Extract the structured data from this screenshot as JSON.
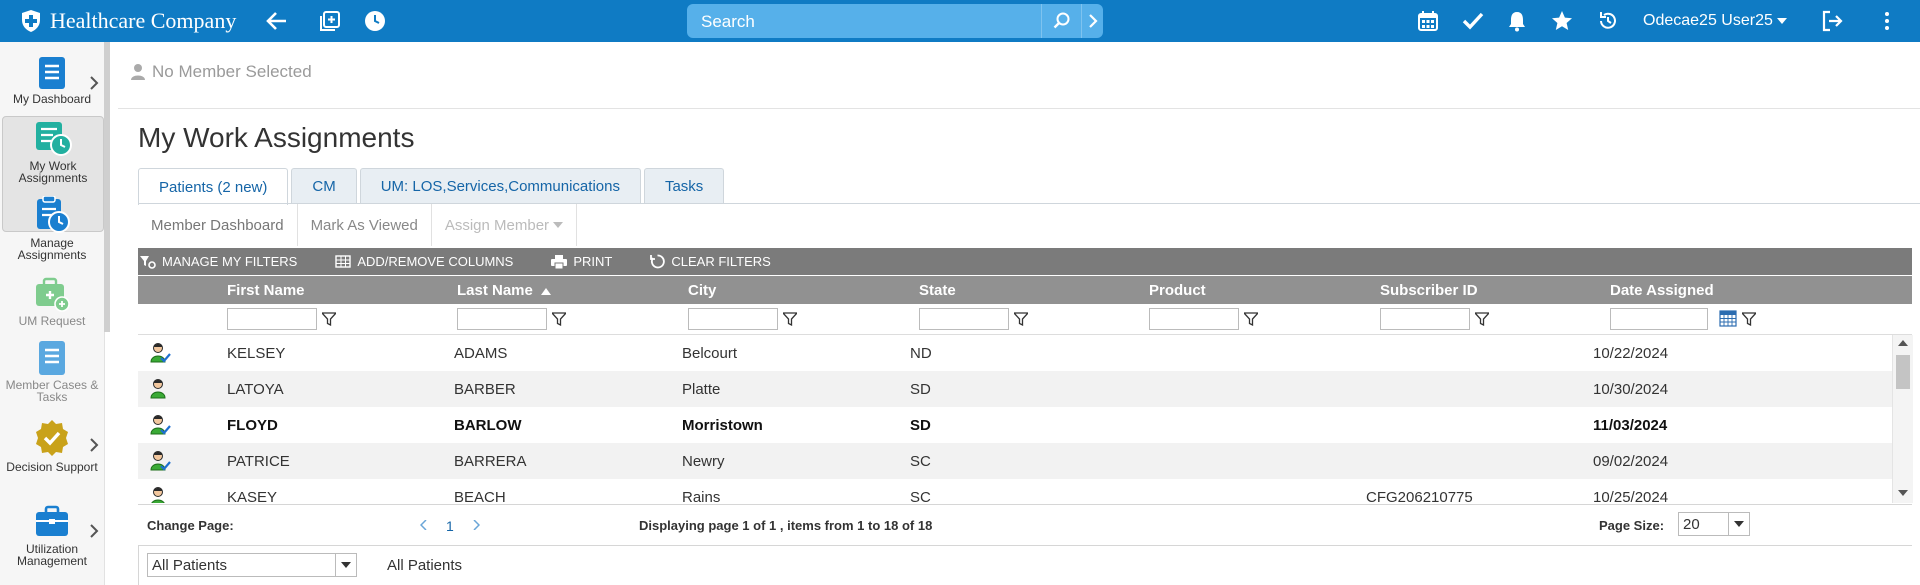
{
  "app": {
    "brand": "Healthcare Company",
    "accent": "#0f7bc4"
  },
  "search": {
    "placeholder": "Search"
  },
  "user": {
    "name": "Odecae25 User25"
  },
  "sidebar": {
    "items": [
      {
        "label": "My Dashboard",
        "icon": "dashboard-doc-icon"
      },
      {
        "label": "My Work Assignments",
        "icon": "work-assignments-icon"
      },
      {
        "label": "Manage Assignments",
        "icon": "manage-assignments-icon"
      },
      {
        "label": "UM Request",
        "icon": "um-request-briefcase-icon"
      },
      {
        "label": "Member Cases & Tasks",
        "icon": "member-cases-doc-icon"
      },
      {
        "label": "Decision Support",
        "icon": "decision-support-badge-icon"
      },
      {
        "label": "Utilization Management",
        "icon": "utilization-briefcase-icon"
      }
    ]
  },
  "member": {
    "status": "No Member Selected"
  },
  "page": {
    "title": "My Work Assignments"
  },
  "tabs": [
    {
      "label": "Patients (2 new)"
    },
    {
      "label": "CM"
    },
    {
      "label": "UM: LOS,Services,Communications"
    },
    {
      "label": "Tasks"
    }
  ],
  "actions": {
    "member_dashboard": "Member Dashboard",
    "mark_as_viewed": "Mark As Viewed",
    "assign_member": "Assign Member"
  },
  "grid": {
    "toolbar": {
      "manage_filters": "MANAGE MY FILTERS",
      "add_remove_columns": "ADD/REMOVE COLUMNS",
      "print": "PRINT",
      "clear_filters": "CLEAR FILTERS"
    },
    "columns": {
      "first_name": "First Name",
      "last_name": "Last Name",
      "city": "City",
      "state": "State",
      "product": "Product",
      "subscriber_id": "Subscriber ID",
      "date_assigned": "Date Assigned"
    },
    "rows": [
      {
        "first": "KELSEY",
        "last": "ADAMS",
        "city": "Belcourt",
        "state": "ND",
        "product": "",
        "subscriber": "",
        "date": "10/22/2024"
      },
      {
        "first": "LATOYA",
        "last": "BARBER",
        "city": "Platte",
        "state": "SD",
        "product": "",
        "subscriber": "",
        "date": "10/30/2024"
      },
      {
        "first": "FLOYD",
        "last": "BARLOW",
        "city": "Morristown",
        "state": "SD",
        "product": "",
        "subscriber": "",
        "date": "11/03/2024"
      },
      {
        "first": "PATRICE",
        "last": "BARRERA",
        "city": "Newry",
        "state": "SC",
        "product": "",
        "subscriber": "",
        "date": "09/02/2024"
      },
      {
        "first": "KASEY",
        "last": "BEACH",
        "city": "Rains",
        "state": "SC",
        "product": "",
        "subscriber": "CFG206210775",
        "date": "10/25/2024"
      }
    ],
    "pager": {
      "change_page": "Change Page:",
      "current_page": "1",
      "summary": "Displaying page 1 of 1 , items from 1 to 18 of 18",
      "page_size_label": "Page Size:",
      "page_size": "20"
    }
  },
  "bottom": {
    "filter_select": "All Patients",
    "filter_label": "All Patients"
  }
}
